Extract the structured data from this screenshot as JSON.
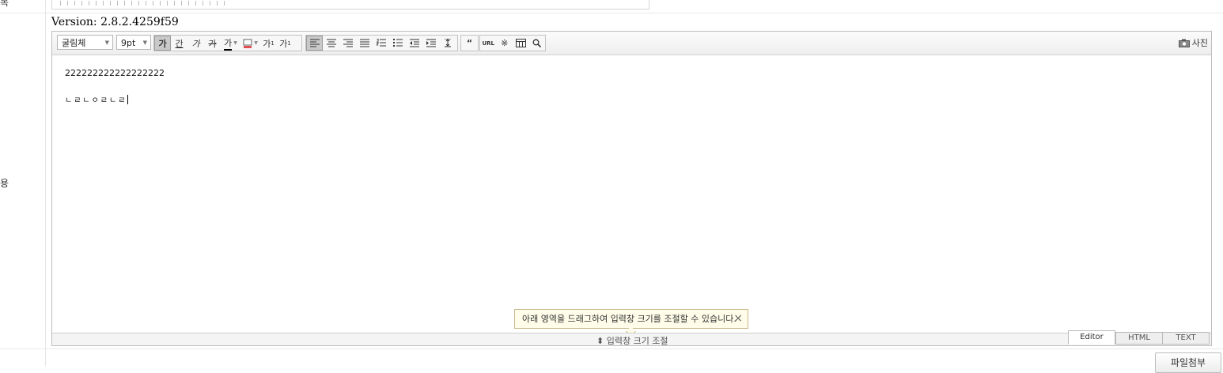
{
  "form": {
    "label_top": "목",
    "label_content": "용",
    "version_text": "Version: 2.8.2.4259f59"
  },
  "toolbar": {
    "font_family": "굴림체",
    "font_size": "9pt",
    "bold": "가",
    "underline": "간",
    "italic": "가",
    "strike": "가",
    "font_color": "가",
    "superscript": "가",
    "subscript": "가",
    "quote": "“",
    "url": "URL",
    "photo": "사진"
  },
  "content": {
    "line1": "222222222222222222",
    "line2": "ㄴㄹㄴㅇㄹㄴㄹ"
  },
  "tooltip": {
    "text": "아래 영역을 드래그하여 입력창 크기를 조절할 수 있습니다.",
    "close": "×"
  },
  "resize": {
    "label": "⬍ 입력창 크기 조절"
  },
  "modes": [
    "Editor",
    "HTML",
    "TEXT"
  ],
  "attach_button": "파일첨부"
}
